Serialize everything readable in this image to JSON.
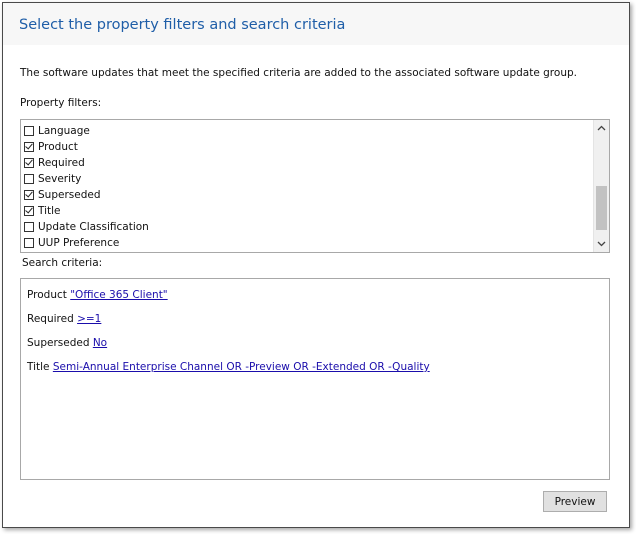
{
  "header": {
    "title": "Select the property filters and search criteria"
  },
  "description": "The software updates that meet the specified criteria are added to the associated software update group.",
  "property_filters": {
    "label": "Property filters:",
    "items": [
      {
        "label": "Language",
        "checked": false
      },
      {
        "label": "Product",
        "checked": true
      },
      {
        "label": "Required",
        "checked": true
      },
      {
        "label": "Severity",
        "checked": false
      },
      {
        "label": "Superseded",
        "checked": true
      },
      {
        "label": "Title",
        "checked": true
      },
      {
        "label": "Update Classification",
        "checked": false
      },
      {
        "label": "UUP Preference",
        "checked": false
      }
    ]
  },
  "search_criteria": {
    "label": "Search criteria:",
    "rows": [
      {
        "name": "Product",
        "value": "\"Office 365 Client\""
      },
      {
        "name": "Required",
        "value": ">=1"
      },
      {
        "name": "Superseded",
        "value": "No"
      },
      {
        "name": "Title",
        "value": "Semi-Annual Enterprise Channel OR -Preview OR -Extended OR -Quality"
      }
    ]
  },
  "buttons": {
    "preview": "Preview"
  },
  "icons": {
    "scroll_up": "chevron-up-icon",
    "scroll_down": "chevron-down-icon"
  },
  "colors": {
    "title": "#1f5ea8",
    "link": "#1a0dab"
  }
}
